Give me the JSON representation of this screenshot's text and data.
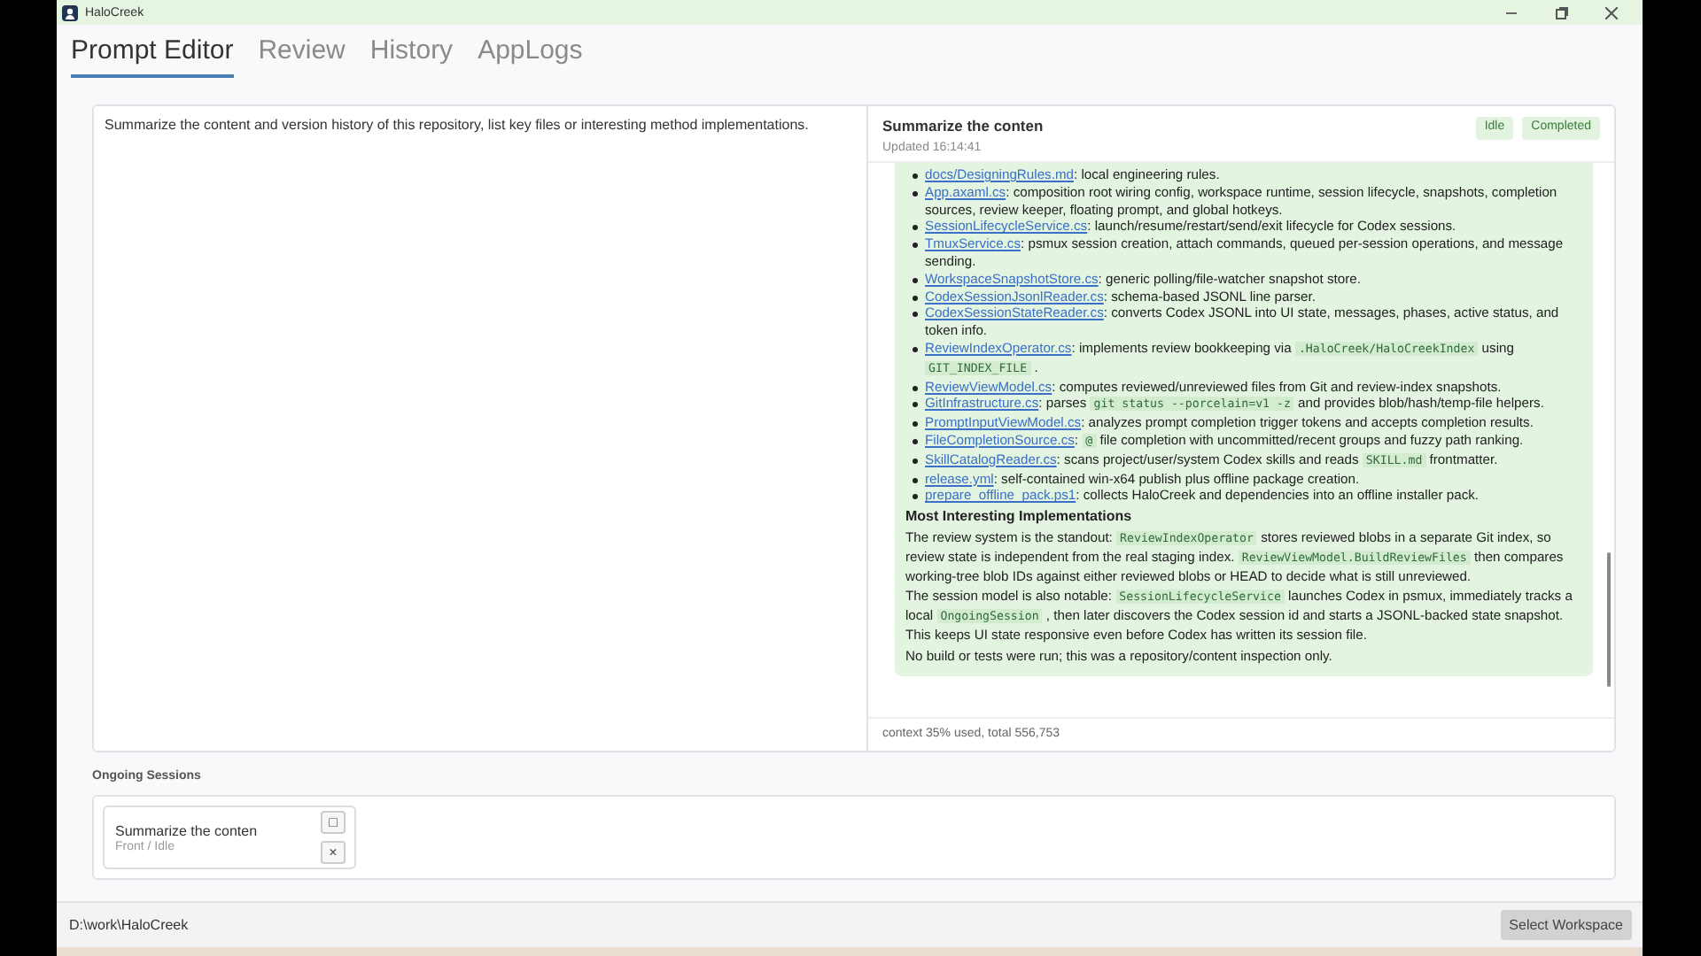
{
  "window": {
    "title": "HaloCreek"
  },
  "tabs": [
    {
      "label": "Prompt Editor",
      "selected": true
    },
    {
      "label": "Review",
      "selected": false
    },
    {
      "label": "History",
      "selected": false
    },
    {
      "label": "AppLogs",
      "selected": false
    }
  ],
  "prompt": {
    "value": "Summarize the content and version history of this repository, list key files or interesting method implementations."
  },
  "session_panel": {
    "title": "Summarize the conten",
    "updated": "Updated 16:14:41",
    "badges": [
      "Idle",
      "Completed"
    ],
    "files": [
      {
        "link": "docs/DesigningRules.md",
        "parts": [
          {
            "kind": "text",
            "text": ": local engineering rules."
          }
        ]
      },
      {
        "link": "App.axaml.cs",
        "parts": [
          {
            "kind": "text",
            "text": ": composition root wiring config, workspace runtime, session lifecycle, snapshots, completion sources, review keeper, floating prompt, and global hotkeys."
          }
        ]
      },
      {
        "link": "SessionLifecycleService.cs",
        "parts": [
          {
            "kind": "text",
            "text": ": launch/resume/restart/send/exit lifecycle for Codex sessions."
          }
        ]
      },
      {
        "link": "TmuxService.cs",
        "parts": [
          {
            "kind": "text",
            "text": ": psmux session creation, attach commands, queued per-session operations, and message sending."
          }
        ]
      },
      {
        "link": "WorkspaceSnapshotStore.cs",
        "parts": [
          {
            "kind": "text",
            "text": ": generic polling/file-watcher snapshot store."
          }
        ]
      },
      {
        "link": "CodexSessionJsonlReader.cs",
        "parts": [
          {
            "kind": "text",
            "text": ": schema-based JSONL line parser."
          }
        ]
      },
      {
        "link": "CodexSessionStateReader.cs",
        "parts": [
          {
            "kind": "text",
            "text": ": converts Codex JSONL into UI state, messages, phases, active status, and token info."
          }
        ]
      },
      {
        "link": "ReviewIndexOperator.cs",
        "parts": [
          {
            "kind": "text",
            "text": ": implements review bookkeeping via "
          },
          {
            "kind": "code",
            "text": ".HaloCreek/HaloCreekIndex"
          },
          {
            "kind": "text",
            "text": " using "
          },
          {
            "kind": "code",
            "text": "GIT_INDEX_FILE"
          },
          {
            "kind": "text",
            "text": " ."
          }
        ]
      },
      {
        "link": "ReviewViewModel.cs",
        "parts": [
          {
            "kind": "text",
            "text": ": computes reviewed/unreviewed files from Git and review-index snapshots."
          }
        ]
      },
      {
        "link": "GitInfrastructure.cs",
        "parts": [
          {
            "kind": "text",
            "text": ": parses "
          },
          {
            "kind": "code",
            "text": "git status --porcelain=v1 -z"
          },
          {
            "kind": "text",
            "text": " and provides blob/hash/temp-file helpers."
          }
        ]
      },
      {
        "link": "PromptInputViewModel.cs",
        "parts": [
          {
            "kind": "text",
            "text": ": analyzes prompt completion trigger tokens and accepts completion results."
          }
        ]
      },
      {
        "link": "FileCompletionSource.cs",
        "parts": [
          {
            "kind": "text",
            "text": ": "
          },
          {
            "kind": "code",
            "text": "@"
          },
          {
            "kind": "text",
            "text": " file completion with uncommitted/recent groups and fuzzy path ranking."
          }
        ]
      },
      {
        "link": "SkillCatalogReader.cs",
        "parts": [
          {
            "kind": "text",
            "text": ": scans project/user/system Codex skills and reads "
          },
          {
            "kind": "code",
            "text": "SKILL.md"
          },
          {
            "kind": "text",
            "text": " frontmatter."
          }
        ]
      },
      {
        "link": "release.yml",
        "parts": [
          {
            "kind": "text",
            "text": ": self-contained win-x64 publish plus offline package creation."
          }
        ]
      },
      {
        "link": "prepare_offline_pack.ps1",
        "parts": [
          {
            "kind": "text",
            "text": ": collects HaloCreek and dependencies into an offline installer pack."
          }
        ]
      }
    ],
    "heading": "Most Interesting Implementations",
    "paragraphs": [
      [
        {
          "kind": "text",
          "text": "The review system is the standout: "
        },
        {
          "kind": "code",
          "text": "ReviewIndexOperator"
        },
        {
          "kind": "text",
          "text": " stores reviewed blobs in a separate Git index, so review state is independent from the real staging index. "
        },
        {
          "kind": "code",
          "text": "ReviewViewModel.BuildReviewFiles"
        },
        {
          "kind": "text",
          "text": " then compares working-tree blob IDs against either reviewed blobs or HEAD to decide what is still unreviewed."
        }
      ],
      [
        {
          "kind": "text",
          "text": "The session model is also notable: "
        },
        {
          "kind": "code",
          "text": "SessionLifecycleService"
        },
        {
          "kind": "text",
          "text": " launches Codex in psmux, immediately tracks a local "
        },
        {
          "kind": "code",
          "text": "OngoingSession"
        },
        {
          "kind": "text",
          "text": " , then later discovers the Codex session id and starts a JSONL-backed state snapshot. This keeps UI state responsive even before Codex has written its session file."
        }
      ],
      [
        {
          "kind": "text",
          "text": "No build or tests were run; this was a repository/content inspection only."
        }
      ]
    ],
    "context": "context 35% used, total 556,753"
  },
  "ongoing": {
    "label": "Ongoing Sessions",
    "sessions": [
      {
        "title": "Summarize the conten",
        "status": "Front / Idle",
        "buttons": [
          "□",
          "×"
        ]
      }
    ]
  },
  "footer": {
    "path": "D:\\work\\HaloCreek",
    "button": "Select Workspace"
  }
}
